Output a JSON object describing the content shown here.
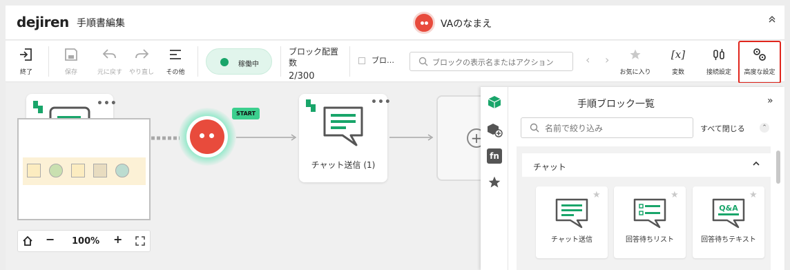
{
  "header": {
    "logo": "dejiren",
    "title": "手順書編集",
    "va_name": "VAのなまえ",
    "collapse_icon": "^"
  },
  "toolbar": {
    "exit_label": "終了",
    "save_label": "保存",
    "undo_label": "元に戻す",
    "redo_label": "やり直し",
    "more_label": "その他",
    "status_label": "稼働中",
    "block_count_label": "ブロック配置数",
    "block_count_value": "2/300",
    "checkbox_label": "ブロ…",
    "search_placeholder": "ブロックの表示名またはアクション",
    "favorites_label": "お気に入り",
    "variables_label": "変数",
    "connection_label": "接続設定",
    "advanced_label": "高度な設定"
  },
  "canvas": {
    "start_tag": "START",
    "chat_node_label": "チャット送信 (1)",
    "zoom_level": "100%"
  },
  "panel": {
    "title": "手順ブロック一覧",
    "search_placeholder": "名前で絞り込み",
    "collapse_all": "すべて閉じる",
    "category": "チャット",
    "blocks": [
      {
        "label": "チャット送信",
        "icon": "chat-bubble-icon"
      },
      {
        "label": "回答待ちリスト",
        "icon": "checklist-bubble-icon"
      },
      {
        "label": "回答待ちテキスト",
        "icon": "qa-bubble-icon"
      }
    ]
  },
  "colors": {
    "accent": "#19a56a",
    "va_red": "#e84b3c",
    "highlight": "#e0251c"
  }
}
